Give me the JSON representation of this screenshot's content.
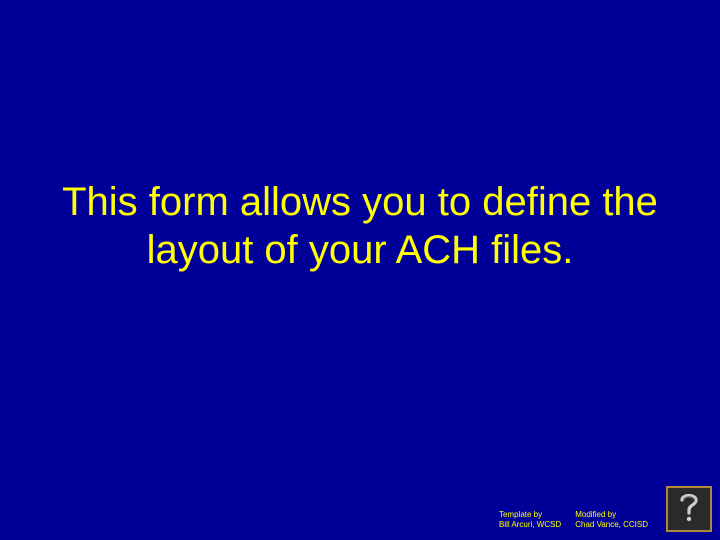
{
  "main_text": "This form allows you to define the layout of your ACH files.",
  "credits": {
    "template": {
      "label": "Template by",
      "author": "Bill Arcuri, WCSD"
    },
    "modified": {
      "label": "Modified by",
      "author": "Chad Vance, CCISD"
    }
  },
  "help_icon": "help-icon"
}
